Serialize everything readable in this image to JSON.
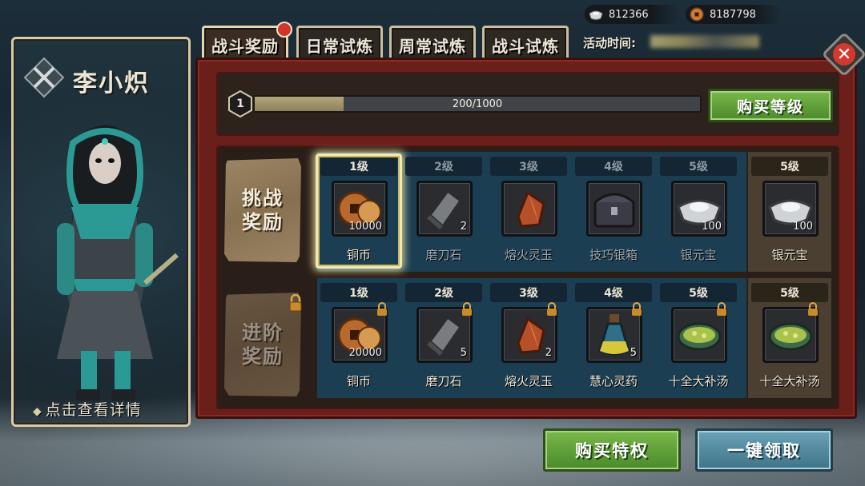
{
  "currencies": [
    {
      "icon": "silver-ingot-icon",
      "value": "812366"
    },
    {
      "icon": "copper-coin-icon",
      "value": "8187798"
    }
  ],
  "activity": {
    "label": "活动时间:"
  },
  "tabs": [
    {
      "label": "战斗奖励",
      "active": true,
      "has_notice": true
    },
    {
      "label": "日常试炼",
      "active": false
    },
    {
      "label": "周常试炼",
      "active": false
    },
    {
      "label": "战斗试炼",
      "active": false
    }
  ],
  "character": {
    "name": "李小炽",
    "detail_link": "点击查看详情"
  },
  "level": {
    "current": "1",
    "progress_text": "200/1000",
    "progress_current": 200,
    "progress_max": 1000,
    "buy_level_label": "购买等级"
  },
  "rows": [
    {
      "label": "挑战\n奖励",
      "locked": false,
      "items": [
        {
          "level": "1级",
          "name": "铜币",
          "qty": "10000",
          "icon": "copper-coin-icon",
          "state": "selected"
        },
        {
          "level": "2级",
          "name": "磨刀石",
          "qty": "2",
          "icon": "whetstone-icon",
          "state": "dim"
        },
        {
          "level": "3级",
          "name": "熔火灵玉",
          "qty": "",
          "icon": "fire-jade-icon",
          "state": "dim"
        },
        {
          "level": "4级",
          "name": "技巧银箱",
          "qty": "",
          "icon": "silver-chest-icon",
          "state": "dim"
        },
        {
          "level": "5级",
          "name": "银元宝",
          "qty": "100",
          "icon": "silver-ingot-icon",
          "state": "dim"
        },
        {
          "level": "5级",
          "name": "银元宝",
          "qty": "100",
          "icon": "silver-ingot-icon",
          "state": "premium"
        }
      ]
    },
    {
      "label": "进阶\n奖励",
      "locked": true,
      "items": [
        {
          "level": "1级",
          "name": "铜币",
          "qty": "20000",
          "icon": "copper-coin-icon",
          "state": "normal"
        },
        {
          "level": "2级",
          "name": "磨刀石",
          "qty": "5",
          "icon": "whetstone-icon",
          "state": "normal"
        },
        {
          "level": "3级",
          "name": "熔火灵玉",
          "qty": "2",
          "icon": "fire-jade-icon",
          "state": "normal"
        },
        {
          "level": "4级",
          "name": "慧心灵药",
          "qty": "5",
          "icon": "potion-icon",
          "state": "normal"
        },
        {
          "level": "5级",
          "name": "十全大补汤",
          "qty": "",
          "icon": "soup-bowl-icon",
          "state": "normal"
        },
        {
          "level": "5级",
          "name": "十全大补汤",
          "qty": "",
          "icon": "soup-bowl-icon",
          "state": "premium"
        }
      ]
    }
  ],
  "buttons": {
    "buy_privilege": "购买特权",
    "claim_all": "一键领取"
  },
  "colors": {
    "frame_red": "#6b1f1b",
    "button_green": "#5fa03a",
    "button_blue": "#5a92a8",
    "cell_blue": "#1c3e52",
    "notice_red": "#d2352a"
  }
}
